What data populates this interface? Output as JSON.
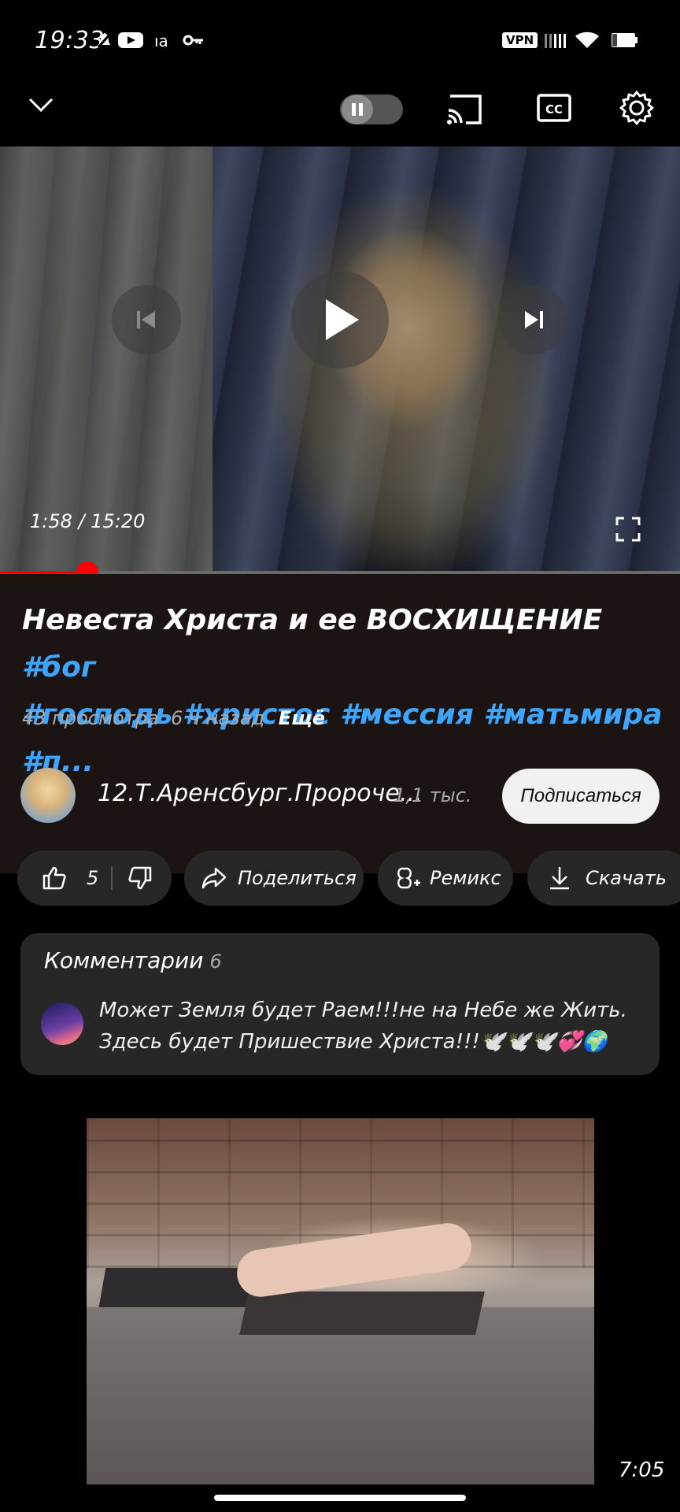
{
  "status_bar": {
    "time": "19:33",
    "extra": "ıa",
    "vpn_label": "VPN"
  },
  "player": {
    "timecode": "1:58 / 15:20",
    "progress_fraction": 0.1286,
    "progress_color": "#ff0000"
  },
  "video": {
    "title_plain": "Невеста Христа и ее ВОСХИЩЕНИЕ",
    "title_tags_line1": "#бог",
    "title_tags_line2": "#господь #христос #мессия #матьмира #п...",
    "views": "43 просмотра",
    "age": "6 ч назад",
    "more": "Ещё"
  },
  "channel": {
    "name": "12.Т.Аренсбург.Пророче...",
    "subscribers": "1,1 тыс.",
    "subscribe_label": "Подписаться"
  },
  "actions": {
    "likes": "5",
    "share": "Поделиться",
    "remix": "Ремикс",
    "download": "Скачать"
  },
  "comments": {
    "title": "Комментарии",
    "count": "6",
    "top_comment": "Может Земля будет Раем!!!не на Небе же Жить. Здесь будет Пришествие Христа!!!🕊️🕊️🕊️💞🌍"
  },
  "recommended": {
    "duration": "7:05"
  },
  "colors": {
    "link": "#3ea6ff",
    "accent": "#ff0000",
    "pill_bg": "#272727"
  }
}
